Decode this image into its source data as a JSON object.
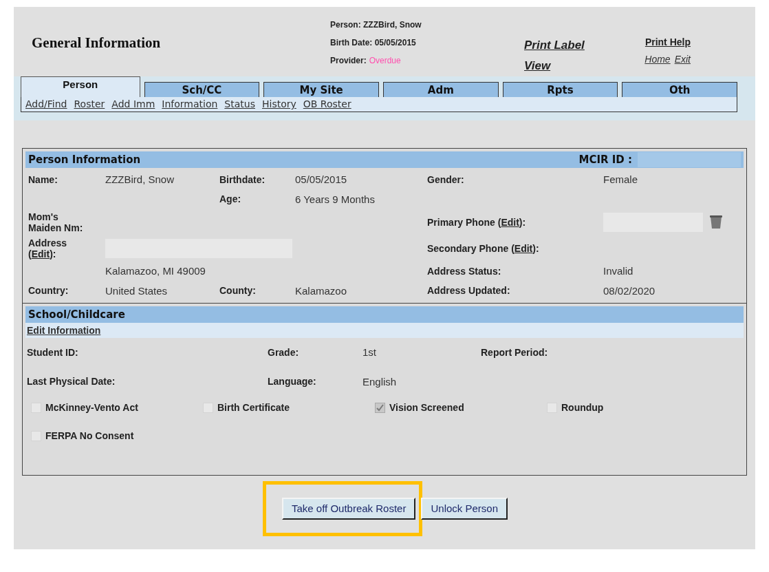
{
  "header": {
    "title": "General Information",
    "person": "Person: ZZZBird, Snow",
    "birth_date": "Birth Date: 05/05/2015",
    "provider_label": "Provider:",
    "provider_status": "Overdue",
    "print_label": "Print Label",
    "view": "View",
    "print_help": "Print Help",
    "home": "Home",
    "exit": "Exit"
  },
  "tabs": [
    {
      "label": "Person",
      "selected": true
    },
    {
      "label": "Sch/CC",
      "selected": false
    },
    {
      "label": "My Site",
      "selected": false
    },
    {
      "label": "Adm",
      "selected": false
    },
    {
      "label": "Rpts",
      "selected": false
    },
    {
      "label": "Oth",
      "selected": false
    }
  ],
  "subnav": [
    "Add/Find",
    "Roster",
    "Add Imm",
    "Information",
    "Status",
    "History",
    "OB Roster"
  ],
  "person_info": {
    "title": "Person Information",
    "id_label": "MCIR ID :",
    "name_label": "Name:",
    "name": "ZZZBird, Snow",
    "birthdate_label": "Birthdate:",
    "birthdate": "05/05/2015",
    "gender_label": "Gender:",
    "gender": "Female",
    "age_label": "Age:",
    "age": "6 Years 9 Months",
    "maiden_label_1": "Mom's",
    "maiden_label_2": "Maiden Nm:",
    "primary_phone_label": "Primary Phone (",
    "edit": "Edit",
    "label_end": "):",
    "address_label": "Address",
    "open_paren": "(",
    "address_edit": "Edit",
    "secondary_phone_label": "Secondary Phone (",
    "secondary_edit": "Edit",
    "city": "Kalamazoo, MI 49009",
    "address_status_label": "Address Status:",
    "address_status": "Invalid",
    "country_label": "Country:",
    "country": "United States",
    "county_label": "County:",
    "county": "Kalamazoo",
    "address_updated_label": "Address Updated:",
    "address_updated": "08/02/2020"
  },
  "school": {
    "title": "School/Childcare",
    "edit_link": "Edit Information",
    "student_id_label": "Student ID:",
    "grade_label": "Grade:",
    "grade": "1st",
    "report_period_label": "Report Period:",
    "physical_label": "Last Physical Date:",
    "language_label": "Language:",
    "language": "English",
    "checkboxes": [
      {
        "label": "McKinney-Vento Act",
        "checked": false
      },
      {
        "label": "Birth Certificate",
        "checked": false
      },
      {
        "label": "Vision Screened",
        "checked": true
      },
      {
        "label": "Roundup",
        "checked": false
      },
      {
        "label": "FERPA No Consent",
        "checked": false
      }
    ]
  },
  "buttons": [
    {
      "label": "Take off Outbreak Roster",
      "highlighted": true
    },
    {
      "label": "Unlock Person"
    }
  ]
}
